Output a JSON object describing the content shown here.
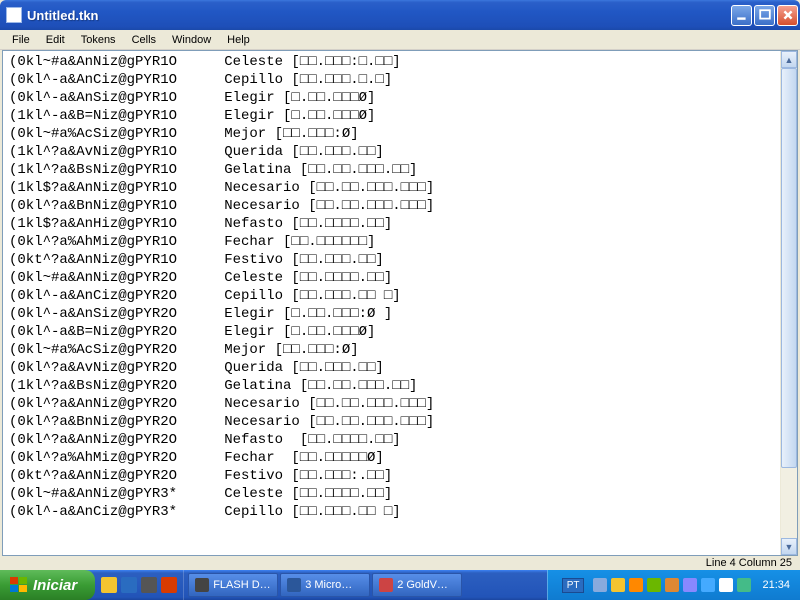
{
  "window": {
    "title": "Untitled.tkn"
  },
  "menu": {
    "items": [
      "File",
      "Edit",
      "Tokens",
      "Cells",
      "Window",
      "Help"
    ]
  },
  "content": {
    "lines": [
      {
        "code": "(0kl~#a&AnNiz@gPYR1O",
        "word": "Celeste",
        "bracket": "[□□.□□□:□.□□]"
      },
      {
        "code": "(0kl^-a&AnCiz@gPYR1O",
        "word": "Cepillo",
        "bracket": "[□□.□□□.□.□]"
      },
      {
        "code": "(0kl^-a&AnSiz@gPYR1O",
        "word": "Elegir",
        "bracket": "[□.□□.□□□Ø]"
      },
      {
        "code": "(1kl^-a&B=Niz@gPYR1O",
        "word": "Elegir",
        "bracket": "[□.□□.□□□Ø]"
      },
      {
        "code": "(0kl~#a%AcSiz@gPYR1O",
        "word": "Mejor",
        "bracket": "[□□.□□□:Ø]"
      },
      {
        "code": "(1kl^?a&AvNiz@gPYR1O",
        "word": "Querida",
        "bracket": "[□□.□□□.□□]"
      },
      {
        "code": "(1kl^?a&BsNiz@gPYR1O",
        "word": "Gelatina",
        "bracket": "[□□.□□.□□□.□□]"
      },
      {
        "code": "(1kl$?a&AnNiz@gPYR1O",
        "word": "Necesario",
        "bracket": "[□□.□□.□□□.□□□]"
      },
      {
        "code": "(0kl^?a&BnNiz@gPYR1O",
        "word": "Necesario",
        "bracket": "[□□.□□.□□□.□□□]"
      },
      {
        "code": "(1kl$?a&AnHiz@gPYR1O",
        "word": "Nefasto",
        "bracket": "[□□.□□□□.□□]"
      },
      {
        "code": "(0kl^?a%AhMiz@gPYR1O",
        "word": "Fechar",
        "bracket": "[□□.□□□□□□]"
      },
      {
        "code": "(0kt^?a&AnNiz@gPYR1O",
        "word": "Festivo",
        "bracket": "[□□.□□□.□□]"
      },
      {
        "code": "(0kl~#a&AnNiz@gPYR2O",
        "word": "Celeste",
        "bracket": "[□□.□□□□.□□]"
      },
      {
        "code": "(0kl^-a&AnCiz@gPYR2O",
        "word": "Cepillo",
        "bracket": "[□□.□□□.□□ □]"
      },
      {
        "code": "(0kl^-a&AnSiz@gPYR2O",
        "word": "Elegir",
        "bracket": "[□.□□.□□□:Ø ]"
      },
      {
        "code": "(0kl^-a&B=Niz@gPYR2O",
        "word": "Elegir",
        "bracket": "[□.□□.□□□Ø]"
      },
      {
        "code": "(0kl~#a%AcSiz@gPYR2O",
        "word": "Mejor",
        "bracket": "[□□.□□□:Ø]"
      },
      {
        "code": "(0kl^?a&AvNiz@gPYR2O",
        "word": "Querida",
        "bracket": "[□□.□□□.□□]"
      },
      {
        "code": "(1kl^?a&BsNiz@gPYR2O",
        "word": "Gelatina",
        "bracket": "[□□.□□.□□□.□□]"
      },
      {
        "code": "(0kl^?a&AnNiz@gPYR2O",
        "word": "Necesario",
        "bracket": "[□□.□□.□□□.□□□]"
      },
      {
        "code": "(0kl^?a&BnNiz@gPYR2O",
        "word": "Necesario",
        "bracket": "[□□.□□.□□□.□□□]"
      },
      {
        "code": "(0kl^?a&AnNiz@gPYR2O",
        "word": "Nefasto ",
        "bracket": "[□□.□□□□.□□]"
      },
      {
        "code": "(0kl^?a%AhMiz@gPYR2O",
        "word": "Fechar ",
        "bracket": "[□□.□□□□□Ø]"
      },
      {
        "code": "(0kt^?a&AnNiz@gPYR2O",
        "word": "Festivo",
        "bracket": "[□□.□□□:.□□]"
      },
      {
        "code": "(0kl~#a&AnNiz@gPYR3*",
        "word": "Celeste",
        "bracket": "[□□.□□□□.□□]"
      },
      {
        "code": "(0kl^-a&AnCiz@gPYR3*",
        "word": "Cepillo",
        "bracket": "[□□.□□□.□□ □]"
      }
    ]
  },
  "status": {
    "text": "Line 4 Column 25"
  },
  "taskbar": {
    "start": "Iniciar",
    "items": [
      {
        "label": "FLASH D…",
        "color": "#444"
      },
      {
        "label": "3 Micro…",
        "color": "#2b579a"
      },
      {
        "label": "2 GoldV…",
        "color": "#c44"
      }
    ],
    "lang": "PT",
    "clock": "21:34"
  },
  "ql_colors": [
    "#f4c430",
    "#2a6cc0",
    "#555",
    "#d83b01"
  ],
  "tray_colors": [
    "#8ad",
    "#f4c430",
    "#f80",
    "#6bb700",
    "#d83",
    "#88f",
    "#4af",
    "#fff",
    "#4b8"
  ]
}
